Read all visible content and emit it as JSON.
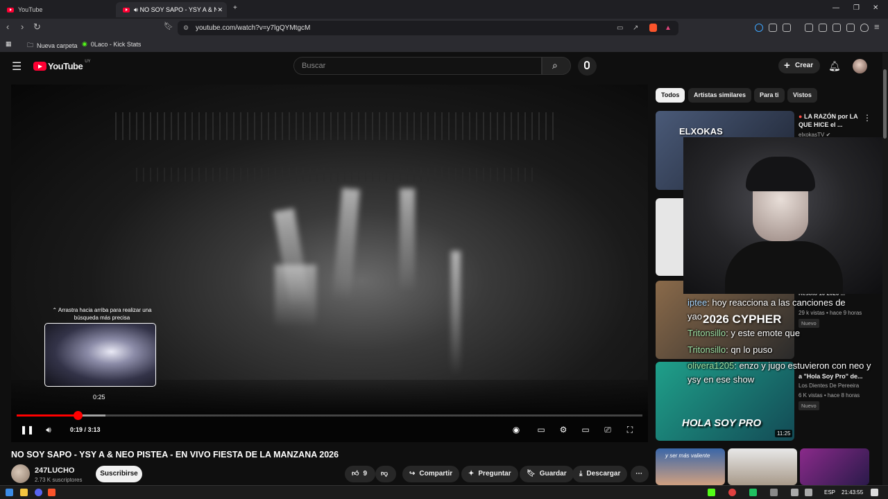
{
  "browser": {
    "tabs": [
      {
        "title": "YouTube"
      },
      {
        "title": "NO SOY SAPO - YSY A & NEO"
      }
    ],
    "url": "youtube.com/watch?v=y7lgQYMtgcM",
    "bookmarks": [
      {
        "label": "Nueva carpeta",
        "icon": "folder-icon"
      },
      {
        "label": "0Laco - Kick Stats",
        "icon": "kick-icon"
      }
    ]
  },
  "youtube": {
    "logo": "YouTube",
    "region": "UY",
    "search_placeholder": "Buscar",
    "create_label": "Crear",
    "player": {
      "hint": "Arrastra hacia arriba para realizar una búsqueda más precisa",
      "preview_time": "0:25",
      "current_time": "0:19",
      "separator": " / ",
      "duration": "3:13",
      "progress_fraction": 0.098,
      "buffer_fraction": 0.142
    },
    "video": {
      "title": "NO SOY SAPO - YSY A & NEO PISTEA - EN VIVO FIESTA DE LA MANZANA 2026",
      "channel": "247LUCHO",
      "subscribers": "2.73 K suscriptores",
      "subscribe_label": "Suscribirse",
      "likes": "9",
      "share_label": "Compartir",
      "ask_label": "Preguntar",
      "save_label": "Guardar",
      "download_label": "Descargar"
    },
    "chips": [
      "Todos",
      "Artistas similares",
      "Para ti",
      "Vistos"
    ],
    "recommendations": [
      {
        "title": "LA RAZÓN por LA QUE HICE el ...",
        "channel": "elxokasTV",
        "thumb_text": "ELXOKAS"
      },
      {
        "title": "Resoto 10 2026 ...",
        "meta": "29 k vistas • hace 9 horas",
        "badge": "Nuevo",
        "thumb_text": "2026 CYPHER"
      },
      {
        "title": "a \"Hola Soy Pro\" de...",
        "channel": "Los Dientes De Pereeira",
        "meta": "6 K vistas • hace 8 horas",
        "badge": "Nuevo",
        "thumb_text": "HOLA SOY PRO",
        "duration": "11:25"
      }
    ],
    "recommendation_extra_texts": [
      "y ser más valiente"
    ]
  },
  "stream_overlay": {
    "chat": [
      {
        "user": "iptee",
        "message": ": hoy reacciona a las canciones de"
      },
      {
        "user": "",
        "message": "yao"
      },
      {
        "user": "Tritonsillo",
        "message": ": y este emote que"
      },
      {
        "user": "Tritonsillo",
        "message": ": qn lo puso"
      },
      {
        "user": "olivera1205",
        "message": ": enzo y jugo estuvieron con neo y"
      },
      {
        "user": "",
        "message": "ysy en ese show"
      }
    ]
  },
  "taskbar": {
    "language": "ESP",
    "clock": "21:43:55"
  },
  "colors": {
    "accent": "#ff0000",
    "background": "#0f0f0f"
  }
}
